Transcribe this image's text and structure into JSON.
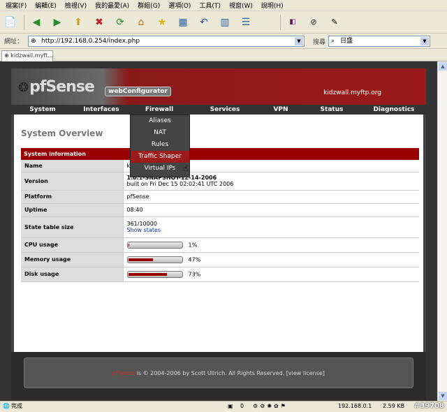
{
  "menu": [
    "檔案(F)",
    "編輯(E)",
    "檢視(V)",
    "我的最愛(A)",
    "群組(G)",
    "選項(O)",
    "工具(T)",
    "視窗(W)",
    "說明(H)"
  ],
  "address": {
    "label": "網址：",
    "url": "http://192.168.0.254/index.php"
  },
  "search": {
    "label": "搜尋",
    "value": "日盛"
  },
  "tab": {
    "label": "kidzwall.myft..."
  },
  "header": {
    "logo": "pfSense",
    "subtitle": "webConfigurator",
    "hostname": "kidzwall.myftp.org"
  },
  "nav": [
    "System",
    "Interfaces",
    "Firewall",
    "Services",
    "VPN",
    "Status",
    "Diagnostics"
  ],
  "dropdown": [
    "Aliases",
    "NAT",
    "Rules",
    "Traffic Shaper",
    "Virtual IPs"
  ],
  "page_title": "System Overview",
  "section_title": "System information",
  "rows": {
    "name": {
      "label": "Name",
      "value": "kid"
    },
    "version": {
      "label": "Version",
      "value": "1.0.1-SNAPSHOT-12-14-2006",
      "built": "built on Fri Dec 15 02:02:41 UTC 2006"
    },
    "platform": {
      "label": "Platform",
      "value": "pfSense"
    },
    "uptime": {
      "label": "Uptime",
      "value": "08:40"
    },
    "state": {
      "label": "State table size",
      "value": "361/10000",
      "link": "Show states"
    },
    "cpu": {
      "label": "CPU usage",
      "value": "1%",
      "fraction": 0.01
    },
    "memory": {
      "label": "Memory usage",
      "value": "47%",
      "fraction": 0.47
    },
    "disk": {
      "label": "Disk usage",
      "value": "73%",
      "fraction": 0.73
    }
  },
  "footer": {
    "brand": "pfSense",
    "text": " is © 2004-2006 by Scott Ullrich. All Rights Reserved. [view license]"
  },
  "status": {
    "text": "完成",
    "count": "0",
    "ip": "192.168.0.1",
    "size": "2.59 KB",
    "watermark": "#39708"
  },
  "colors": {
    "accent": "#990000",
    "nav_bg": "#333333"
  }
}
